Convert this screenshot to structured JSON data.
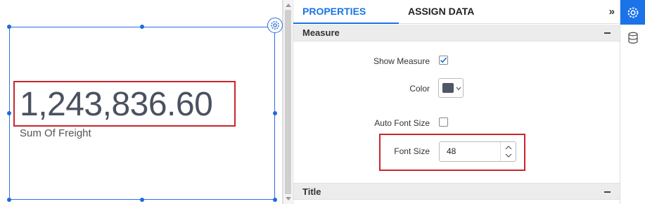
{
  "widget": {
    "value": "1,243,836.60",
    "subtitle": "Sum Of Freight",
    "settings_icon": "gear-icon"
  },
  "panel": {
    "tabs": [
      "PROPERTIES",
      "ASSIGN DATA"
    ],
    "active_tab": "PROPERTIES",
    "collapse_label": "»",
    "sections": [
      {
        "title": "Measure",
        "toggle": "collapse-icon"
      },
      {
        "title": "Title",
        "toggle": "collapse-icon"
      }
    ],
    "properties": {
      "show_measure": {
        "label": "Show Measure",
        "checked": true
      },
      "color": {
        "label": "Color",
        "value": "#4e5667"
      },
      "auto_font_size": {
        "label": "Auto Font Size",
        "checked": false
      },
      "font_size": {
        "label": "Font Size",
        "value": "48"
      }
    }
  },
  "rail": {
    "items": [
      {
        "icon": "gear-icon",
        "active": true
      },
      {
        "icon": "database-icon",
        "active": false
      }
    ]
  },
  "colors": {
    "accent": "#1a73e8",
    "highlight": "#c8262c",
    "value_text": "#4a5260"
  }
}
